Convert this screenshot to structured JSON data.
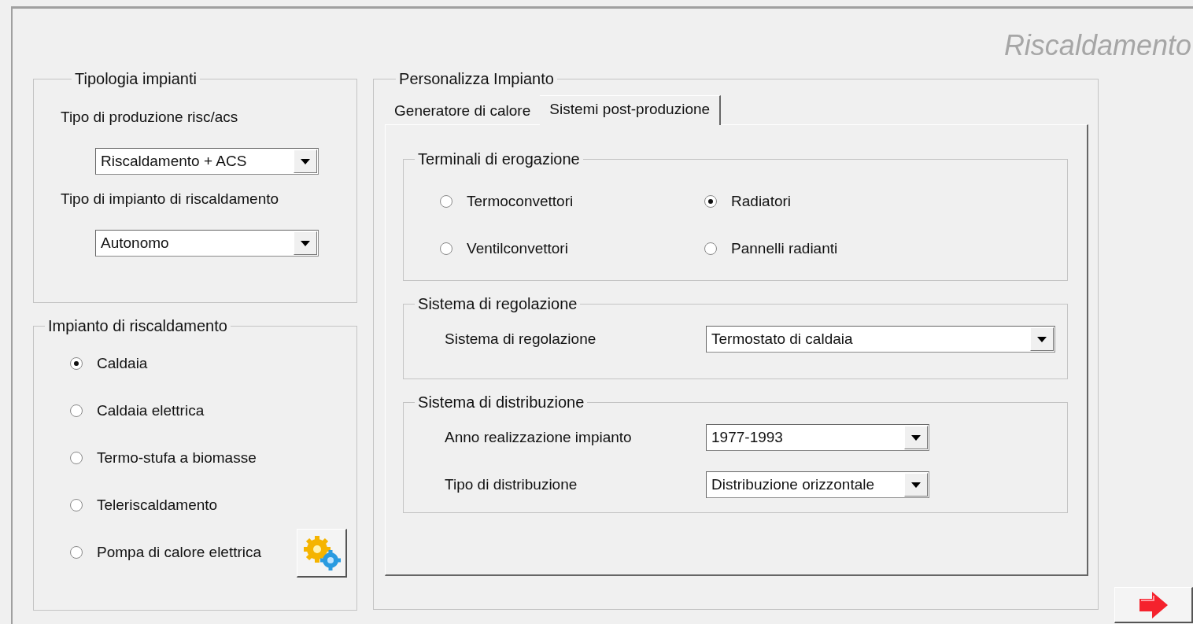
{
  "window": {
    "title": "Riscaldamento"
  },
  "tipologia": {
    "title": "Tipologia impianti",
    "fields": [
      {
        "label": "Tipo di produzione risc/acs",
        "value": "Riscaldamento + ACS"
      },
      {
        "label": "Tipo di impianto di riscaldamento",
        "value": "Autonomo"
      }
    ]
  },
  "impianto": {
    "title": "Impianto di riscaldamento",
    "options": [
      {
        "label": "Caldaia",
        "selected": true
      },
      {
        "label": "Caldaia elettrica",
        "selected": false
      },
      {
        "label": "Termo-stufa a biomasse",
        "selected": false
      },
      {
        "label": "Teleriscaldamento",
        "selected": false
      },
      {
        "label": "Pompa di calore elettrica",
        "selected": false
      }
    ]
  },
  "personalizza": {
    "title": "Personalizza Impianto",
    "tabs": [
      {
        "label": "Generatore di calore",
        "selected": false
      },
      {
        "label": "Sistemi post-produzione",
        "selected": true
      }
    ],
    "terminali": {
      "title": "Terminali di erogazione",
      "options": [
        {
          "label": "Termoconvettori",
          "selected": false
        },
        {
          "label": "Radiatori",
          "selected": true
        },
        {
          "label": "Ventilconvettori",
          "selected": false
        },
        {
          "label": "Pannelli radianti",
          "selected": false
        }
      ]
    },
    "regolazione": {
      "title": "Sistema di regolazione",
      "fields": [
        {
          "label": "Sistema di regolazione",
          "value": "Termostato di caldaia"
        }
      ]
    },
    "distribuzione": {
      "title": "Sistema di distribuzione",
      "fields": [
        {
          "label": "Anno realizzazione impianto",
          "value": "1977-1993"
        },
        {
          "label": "Tipo di distribuzione",
          "value": "Distribuzione orizzontale"
        }
      ]
    }
  }
}
